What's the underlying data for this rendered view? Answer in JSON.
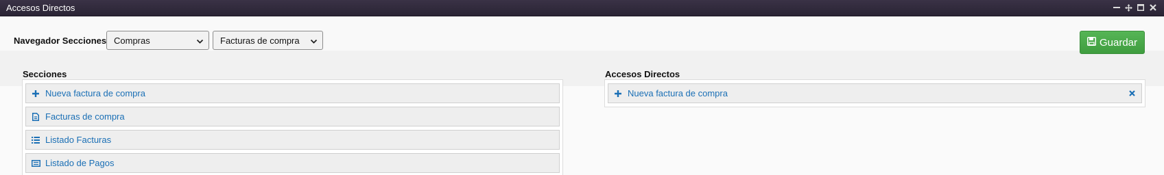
{
  "window": {
    "title": "Accesos Directos",
    "controls": [
      "minimize-icon",
      "move-icon",
      "maximize-icon",
      "close-icon"
    ]
  },
  "navigator": {
    "label": "Navegador Secciones:",
    "section_select": "Compras",
    "page_select": "Facturas de compra"
  },
  "save_button": {
    "label": "Guardar",
    "icon": "save-icon",
    "color": "#4cae4c"
  },
  "sections": {
    "title": "Secciones",
    "items": [
      {
        "label": "Nueva factura de compra",
        "icon": "plus-icon"
      },
      {
        "label": "Facturas de compra",
        "icon": "document-icon"
      },
      {
        "label": "Listado Facturas",
        "icon": "list-icon"
      },
      {
        "label": "Listado de Pagos",
        "icon": "card-list-icon"
      }
    ]
  },
  "shortcuts": {
    "title": "Accesos Directos",
    "items": [
      {
        "label": "Nueva factura de compra",
        "icon": "plus-icon",
        "remove_icon": "remove-icon"
      }
    ]
  },
  "colors": {
    "link": "#1a6fb5",
    "titlebar": "#2f2839"
  }
}
